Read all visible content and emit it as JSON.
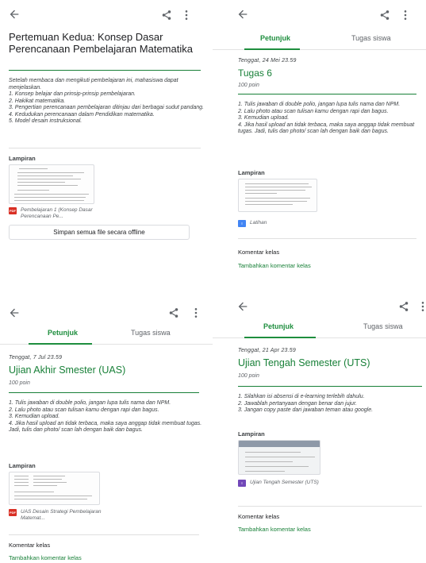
{
  "panels": {
    "p1": {
      "title": "Pertemuan Kedua: Konsep Dasar Perencanaan Pembelajaran Matematika",
      "description": [
        "Setelah membaca dan mengikuti pembelajaran ini, mahasiswa dapat menjelaskan.",
        "1. Konsep belajar dan prinsip-prinsip pembelajaran.",
        "2. Hakikat matematika.",
        "3. Pengertian perencanaan pembelajaran ditinjau dari berbagai sudut pandang.",
        "4. Kedudukan perencanaan dalam Pendidikan matematika.",
        "5. Model desain instruksional."
      ],
      "attachments_label": "Lampiran",
      "attachment_name": "Pembelajaran 1 (Konsep Dasar Perencanaan Pe...",
      "offline_button": "Simpan semua file secara offline"
    },
    "p2": {
      "tabs": [
        "Petunjuk",
        "Tugas siswa"
      ],
      "due": "Tenggat, 24 Mei 23.59",
      "title": "Tugas 6",
      "points": "100 poin",
      "instructions": [
        "1. Tulis jawaban di double polio, jangan lupa tulis nama dan NPM.",
        "2. Lalu photo atau scan tulisan kamu dengan rapi dan bagus.",
        "3. Kemudian upload.",
        "4. Jika hasil upload an tidak terbaca, maka saya anggap tidak membuat tugas. Jadi, tulis dan photo/ scan lah dengan baik dan bagus."
      ],
      "attachments_label": "Lampiran",
      "attachment_name": "Latihan",
      "comments_label": "Komentar kelas",
      "add_comment": "Tambahkan komentar kelas"
    },
    "p3": {
      "tabs": [
        "Petunjuk",
        "Tugas siswa"
      ],
      "due": "Tenggat, 7 Jul 23.59",
      "title": "Ujian Akhir Smester (UAS)",
      "points": "100 poin",
      "instructions": [
        "1. Tulis jawaban di double polio, jangan lupa tulis nama dan NPM.",
        "2. Lalu photo atau scan tulisan kamu dengan rapi dan bagus.",
        "3. Kemudian upload.",
        "4. Jika hasil upload an tidak terbaca, maka saya anggap tidak membuat tugas. Jadi, tulis dan photo/ scan lah dengan baik dan bagus."
      ],
      "attachments_label": "Lampiran",
      "attachment_name": "UAS Desain Strategi Pembelajaran Matemat...",
      "comments_label": "Komentar kelas",
      "add_comment": "Tambahkan komentar kelas"
    },
    "p4": {
      "tabs": [
        "Petunjuk",
        "Tugas siswa"
      ],
      "due": "Tenggat, 21 Apr 23.59",
      "title": "Ujian Tengah Semester (UTS)",
      "points": "100 poin",
      "instructions": [
        "1. Silahkan isi absensi di e-learning terlebih dahulu.",
        "2. Jawablah pertanyaan dengan benar dan jujur.",
        "3. Jangan copy paste dari jawaban teman atau google."
      ],
      "attachments_label": "Lampiran",
      "attachment_name": "Ujian Tengah Semester (UTS)",
      "comments_label": "Komentar kelas",
      "add_comment": "Tambahkan komentar kelas"
    }
  },
  "icons": {
    "back": "arrow-back-icon",
    "share": "share-icon",
    "more": "more-vert-icon",
    "pdf": "pdf-file-icon",
    "doc": "docs-file-icon",
    "form": "forms-file-icon"
  },
  "colors": {
    "accent_green": "#188038",
    "pdf_red": "#d93025",
    "doc_blue": "#4285f4",
    "form_purple": "#7248b9"
  }
}
